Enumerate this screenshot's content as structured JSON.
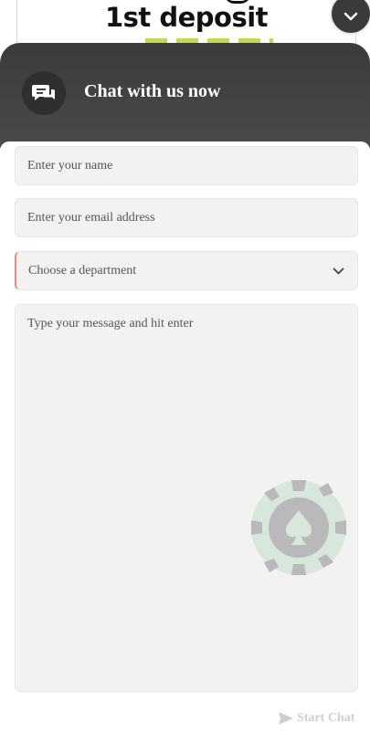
{
  "promo": {
    "title": "1st deposit"
  },
  "header": {
    "title": "Chat with us now",
    "icon": "chat-bubbles-icon",
    "collapse_icon": "chevron-down-icon"
  },
  "form": {
    "name_placeholder": "Enter your name",
    "email_placeholder": "Enter your email address",
    "department_placeholder": "Choose a department",
    "message_placeholder": "Type your message and hit enter",
    "submit_label": "Start Chat",
    "submit_icon": "send-icon"
  },
  "colors": {
    "header_bg": "#424242",
    "field_bg": "#f2f2f0",
    "invalid_accent": "#e88a8a",
    "disabled_text": "#cfcfcf"
  }
}
